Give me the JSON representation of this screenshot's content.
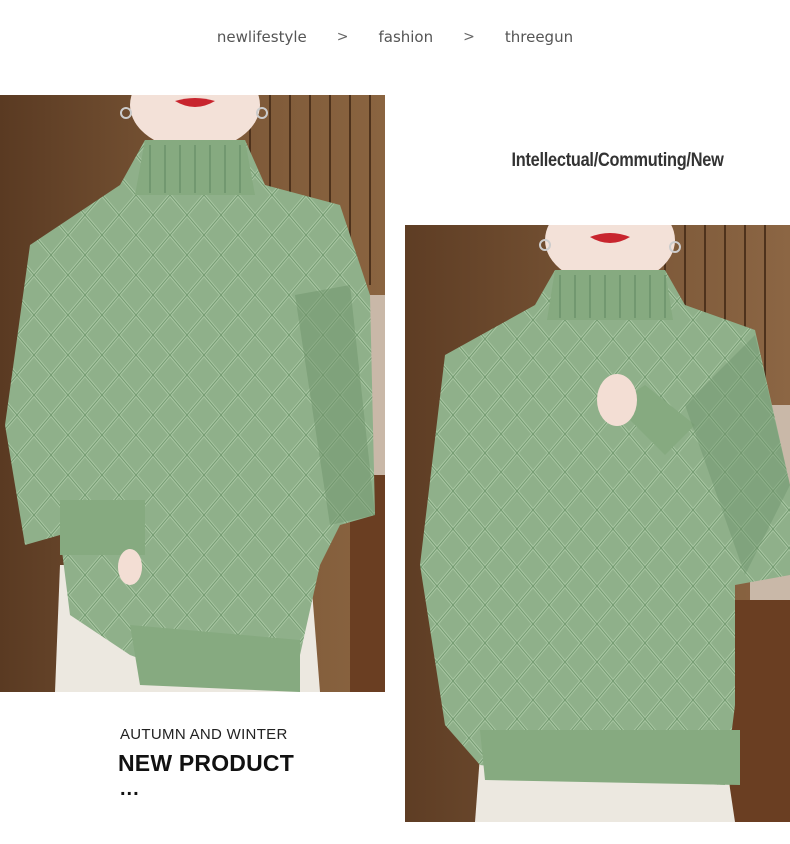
{
  "breadcrumb": {
    "items": [
      "newlifestyle",
      "fashion",
      "threegun"
    ],
    "separator": ">"
  },
  "tagline": "Intellectual/Commuting/New",
  "promo": {
    "season": "AUTUMN AND WINTER",
    "headline": "NEW PRODUCT",
    "ellipsis": "..."
  },
  "colors": {
    "sweater": "#8fb08a",
    "sweater_shadow": "#6f946c",
    "background_wall": "#6b4a2e",
    "pants": "#ece8e0"
  }
}
